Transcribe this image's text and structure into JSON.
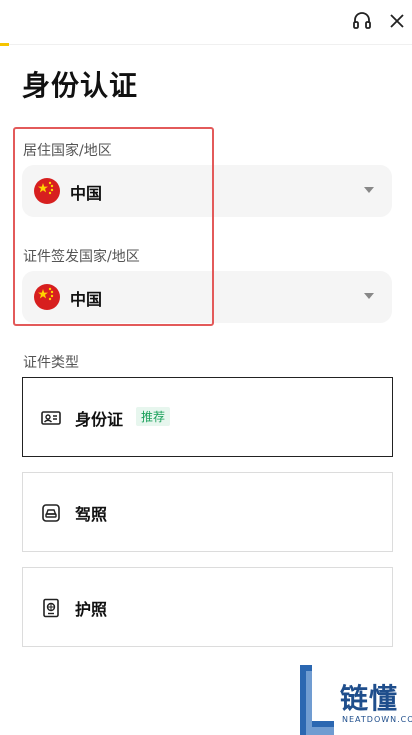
{
  "page_title": "身份认证",
  "header": {
    "support_icon": "headset-icon",
    "close_icon": "close-icon",
    "accent_color": "#f5c400"
  },
  "residence": {
    "label": "居住国家/地区",
    "value": "中国",
    "flag_icon": "china-flag-icon"
  },
  "issuing": {
    "label": "证件签发国家/地区",
    "value": "中国",
    "flag_icon": "china-flag-icon"
  },
  "id_type": {
    "label": "证件类型",
    "options": [
      {
        "label": "身份证",
        "badge": "推荐",
        "icon": "id-card-icon",
        "selected": true
      },
      {
        "label": "驾照",
        "icon": "driver-license-icon",
        "selected": false
      },
      {
        "label": "护照",
        "icon": "passport-icon",
        "selected": false
      }
    ]
  },
  "highlight_color": "#e35a5a",
  "watermark": {
    "title": "链懂",
    "subtitle": "NEATDOWN.COM"
  }
}
